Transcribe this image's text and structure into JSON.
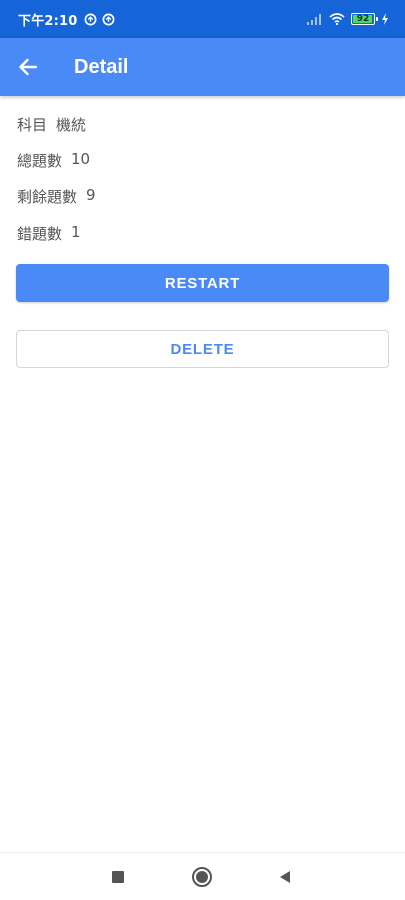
{
  "status_bar": {
    "time": "下午2:10",
    "battery_level": "92",
    "icons": [
      "sync-circle-icon",
      "sync-circle-icon",
      "signal-icon",
      "wifi-icon",
      "battery-icon",
      "charging-icon"
    ]
  },
  "app_bar": {
    "back_icon": "arrow-left-icon",
    "title": "Detail",
    "color": "#4a8af7"
  },
  "details": {
    "subject_label": "科目",
    "subject_value": "機統",
    "total_label": "總題數",
    "total_value": "10",
    "remaining_label": "剩餘題數",
    "remaining_value": "9",
    "wrong_label": "錯題數",
    "wrong_value": "1"
  },
  "actions": {
    "restart_label": "RESTART",
    "delete_label": "DELETE"
  },
  "nav_bar": {
    "icons": [
      "recent-apps-icon",
      "home-icon",
      "back-icon"
    ]
  }
}
